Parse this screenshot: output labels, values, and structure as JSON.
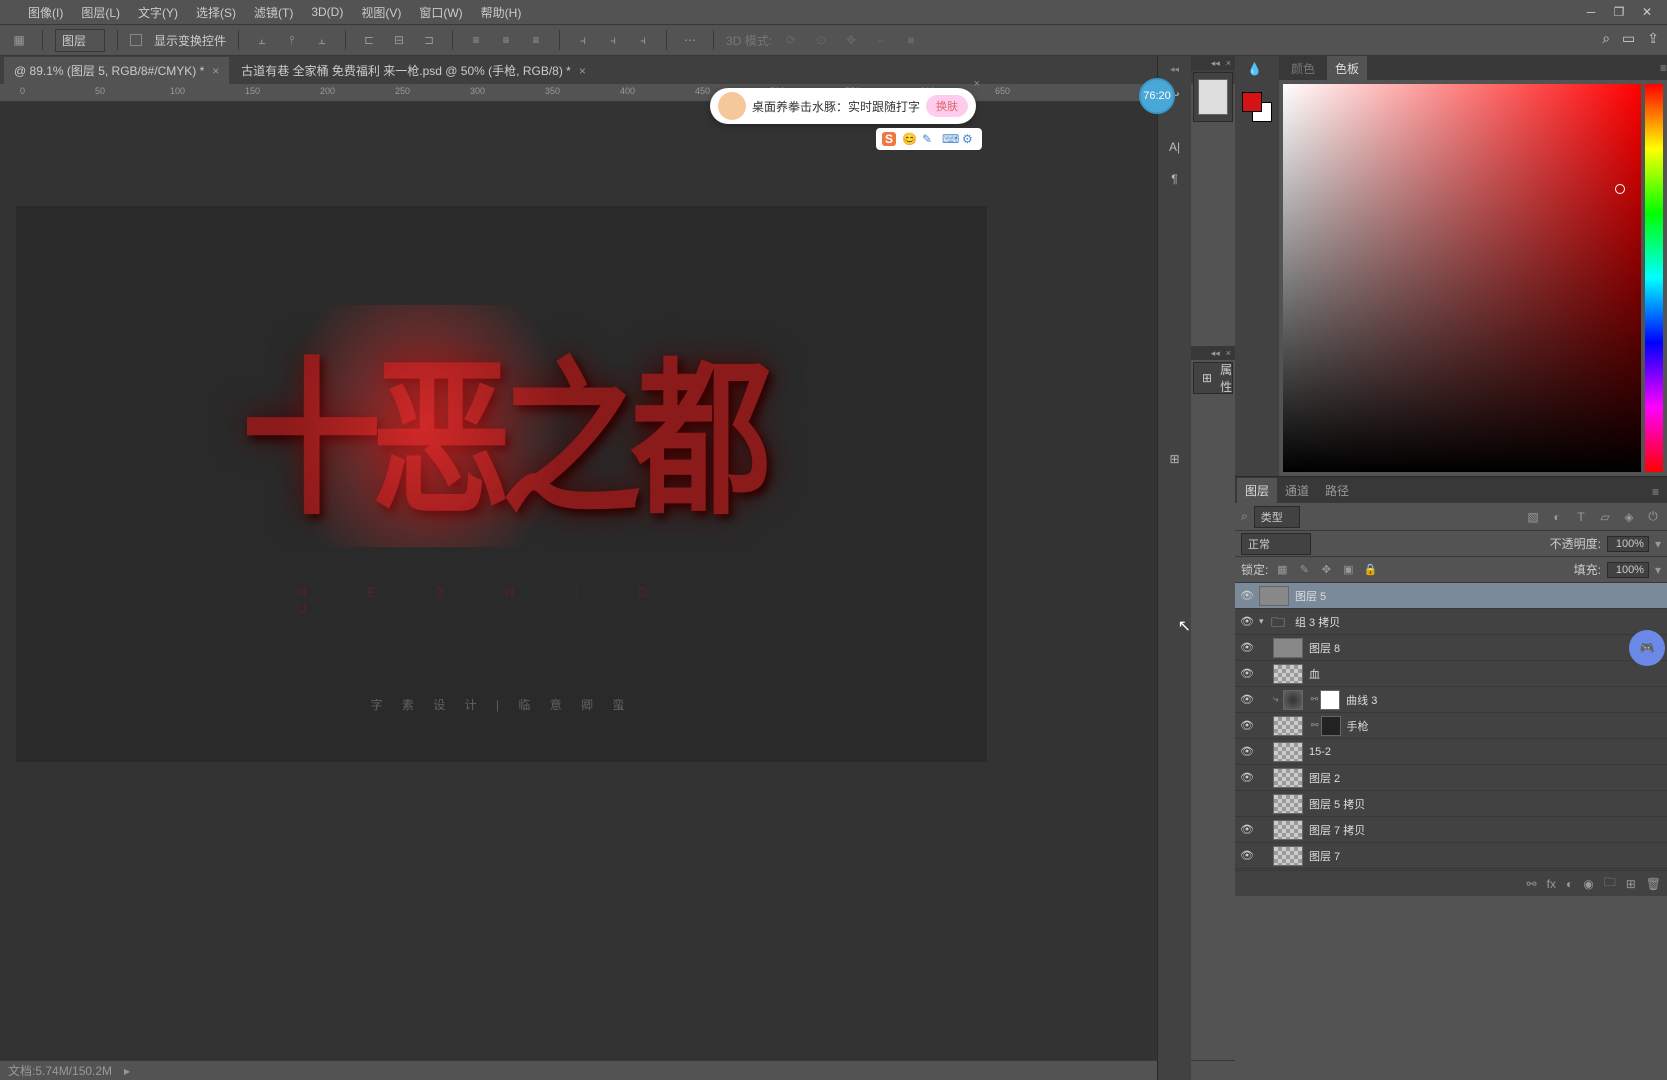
{
  "menu": {
    "image": "图像(I)",
    "layer": "图层(L)",
    "type": "文字(Y)",
    "select": "选择(S)",
    "filter": "滤镜(T)",
    "threed": "3D(D)",
    "view": "视图(V)",
    "window": "窗口(W)",
    "help": "帮助(H)"
  },
  "optbar": {
    "layer_dropdown": "图层",
    "show_transform": "显示变换控件",
    "threed_mode": "3D 模式:"
  },
  "tabs": {
    "t1": "@ 89.1% (图层 5, RGB/8#/CMYK) *",
    "t2": "古道有巷 全家桶 免费福利 来一枪.psd @ 50% (手枪, RGB/8) *"
  },
  "ruler": [
    "0",
    "50",
    "100",
    "150",
    "200",
    "250",
    "300",
    "350",
    "400",
    "450",
    "500",
    "550",
    "600",
    "650"
  ],
  "artwork": {
    "main": "十恶之都",
    "sub": "H   E   Z   H   I   D   U",
    "caption": "字 素 设 计 | 临 意 卿 蛮"
  },
  "statusbar": {
    "doc": "文档:5.74M/150.2M"
  },
  "timer": "76:20",
  "pill": {
    "text": "桌面养拳击水豚：实时跟随打字",
    "btn": "换肤"
  },
  "panels": {
    "color_tab": "颜色",
    "swatch_tab": "色板",
    "props": "属性",
    "layers_tab": "图层",
    "channels_tab": "通道",
    "paths_tab": "路径",
    "filter_label": "类型",
    "blend_mode": "正常",
    "opacity_label": "不透明度:",
    "opacity_val": "100%",
    "lock_label": "锁定:",
    "fill_label": "填充:",
    "fill_val": "100%"
  },
  "layers": [
    {
      "name": "图层 5",
      "sel": true,
      "indent": 0,
      "thumb": "t",
      "eye": true
    },
    {
      "name": "组 3 拷贝",
      "indent": 0,
      "thumb": "f",
      "eye": true,
      "disc": "▾"
    },
    {
      "name": "图层 8",
      "indent": 1,
      "thumb": "t",
      "eye": true
    },
    {
      "name": "血",
      "indent": 1,
      "thumb": "c",
      "eye": true
    },
    {
      "name": "曲线 3",
      "indent": 1,
      "thumb": "a",
      "eye": true
    },
    {
      "name": "手枪",
      "indent": 1,
      "thumb": "cm",
      "eye": true
    },
    {
      "name": "15-2",
      "indent": 1,
      "thumb": "c",
      "eye": true
    },
    {
      "name": "图层 2",
      "indent": 1,
      "thumb": "c",
      "eye": true
    },
    {
      "name": "图层 5 拷贝",
      "indent": 1,
      "thumb": "c",
      "eye": false
    },
    {
      "name": "图层 7 拷贝",
      "indent": 1,
      "thumb": "c",
      "eye": true
    },
    {
      "name": "图层 7",
      "indent": 1,
      "thumb": "c",
      "eye": true
    }
  ]
}
